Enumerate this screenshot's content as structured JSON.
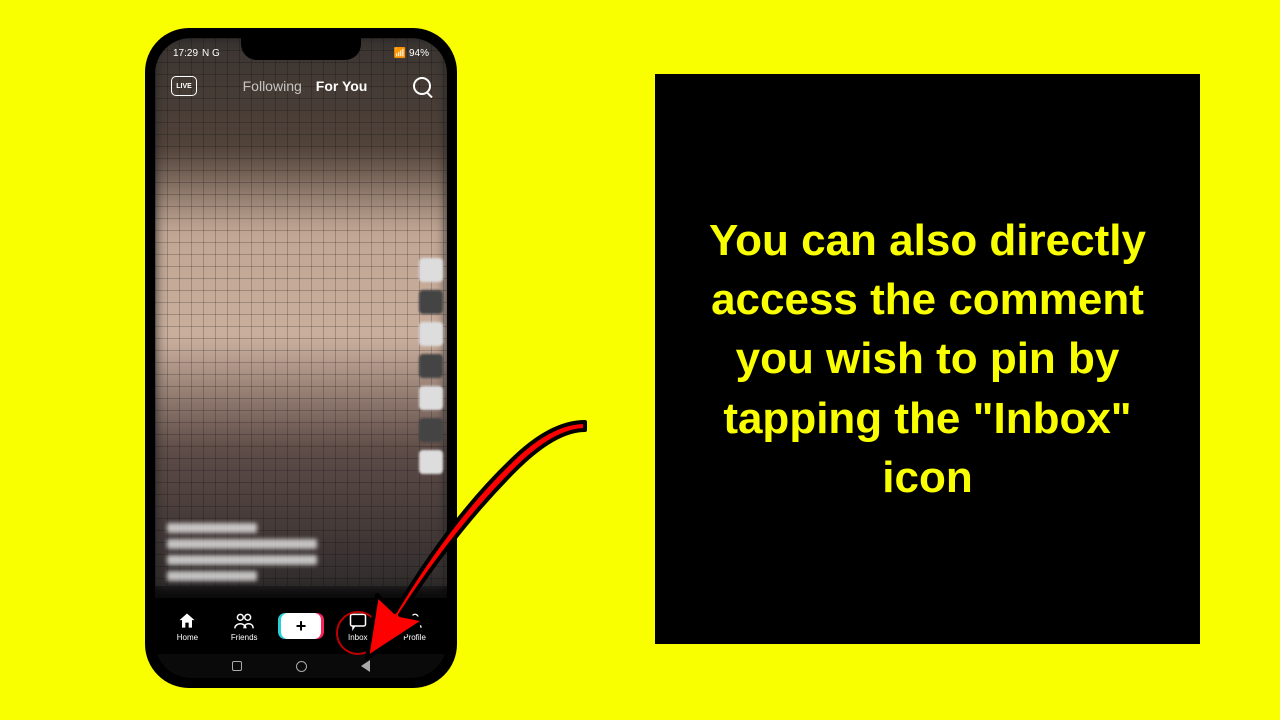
{
  "status": {
    "time": "17:29",
    "indicators": "N G",
    "signal": "📶",
    "battery_text": "94%"
  },
  "topbar": {
    "live": "LIVE",
    "tabs": {
      "following": "Following",
      "foryou": "For You"
    }
  },
  "nav": {
    "home": "Home",
    "friends": "Friends",
    "create": "+",
    "inbox": "Inbox",
    "profile": "Profile"
  },
  "instruction": {
    "text": "You can also directly access the comment you wish to pin by tapping the \"Inbox\" icon"
  }
}
